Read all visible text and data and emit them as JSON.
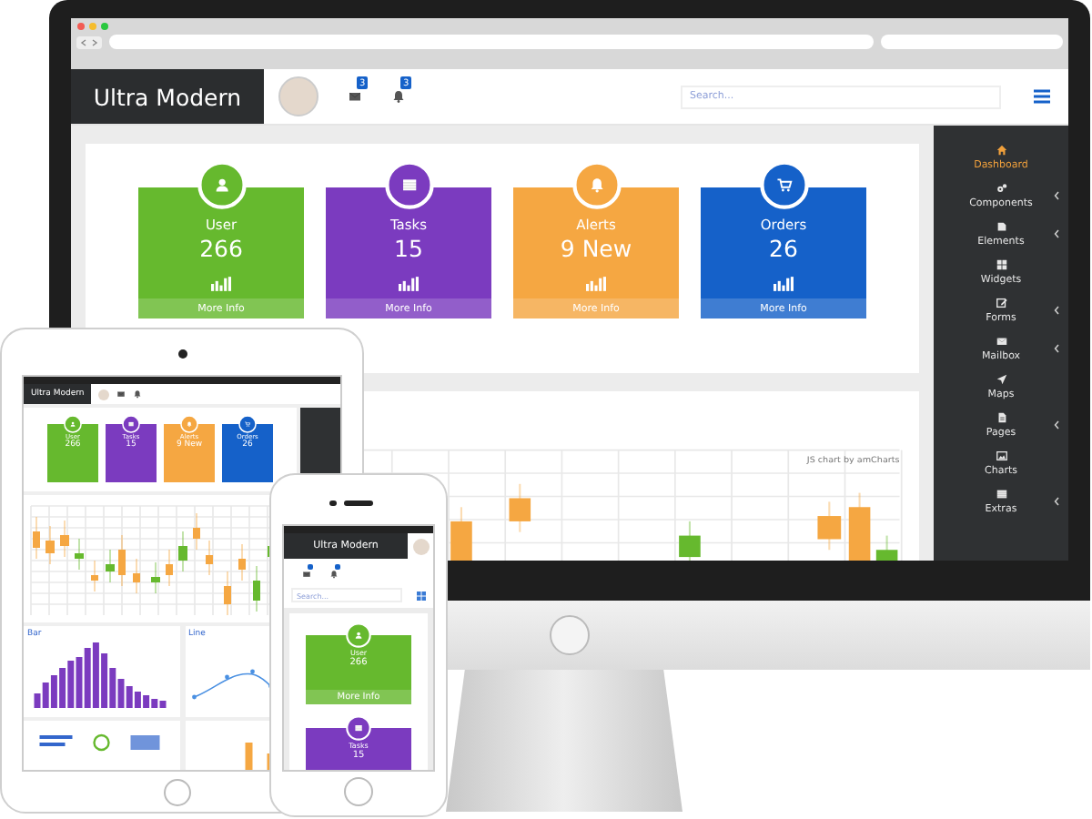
{
  "header": {
    "brand": "Ultra Modern",
    "badges": [
      {
        "kind": "mail",
        "count": "3"
      },
      {
        "kind": "bell",
        "count": "3"
      }
    ],
    "search": {
      "placeholder": "Search..."
    }
  },
  "stat_cards": [
    {
      "kind": "user",
      "label": "User",
      "value": "266",
      "link": "More Info",
      "color": "#66b92e"
    },
    {
      "kind": "tasks",
      "label": "Tasks",
      "value": "15",
      "link": "More Info",
      "color": "#7b3bbf"
    },
    {
      "kind": "alerts",
      "label": "Alerts",
      "value": "9 New",
      "link": "More Info",
      "color": "#f5a742"
    },
    {
      "kind": "orders",
      "label": "Orders",
      "value": "26",
      "link": "More Info",
      "color": "#1561c9"
    }
  ],
  "chart": {
    "credit": "JS chart by amCharts"
  },
  "sidebar": {
    "items": [
      {
        "kind": "dashboard",
        "label": "Dashboard",
        "selected": true,
        "submenu": false
      },
      {
        "kind": "components",
        "label": "Components",
        "selected": false,
        "submenu": true
      },
      {
        "kind": "elements",
        "label": "Elements",
        "selected": false,
        "submenu": true
      },
      {
        "kind": "widgets",
        "label": "Widgets",
        "selected": false,
        "submenu": false
      },
      {
        "kind": "forms",
        "label": "Forms",
        "selected": false,
        "submenu": true
      },
      {
        "kind": "mailbox",
        "label": "Mailbox",
        "selected": false,
        "submenu": true
      },
      {
        "kind": "maps",
        "label": "Maps",
        "selected": false,
        "submenu": false
      },
      {
        "kind": "pages",
        "label": "Pages",
        "selected": false,
        "submenu": true
      },
      {
        "kind": "charts",
        "label": "Charts",
        "selected": false,
        "submenu": false
      },
      {
        "kind": "extras",
        "label": "Extras",
        "selected": false,
        "submenu": true
      }
    ]
  },
  "tablet": {
    "brand": "Ultra Modern",
    "cards": [
      {
        "kind": "user",
        "label": "User",
        "value": "266",
        "color": "#66b92e"
      },
      {
        "kind": "tasks",
        "label": "Tasks",
        "value": "15",
        "color": "#7b3bbf"
      },
      {
        "kind": "alerts",
        "label": "Alerts",
        "value": "9 New",
        "color": "#f5a742"
      },
      {
        "kind": "orders",
        "label": "Orders",
        "value": "26",
        "color": "#1561c9"
      }
    ],
    "panels": [
      {
        "kind": "bar",
        "title": "Bar"
      },
      {
        "kind": "line",
        "title": "Line"
      }
    ]
  },
  "phone": {
    "brand": "Ultra Modern",
    "search": {
      "placeholder": "Search..."
    },
    "cards": [
      {
        "kind": "user",
        "label": "User",
        "value": "266",
        "link": "More Info",
        "color": "#66b92e"
      },
      {
        "kind": "tasks",
        "label": "Tasks",
        "value": "15",
        "color": "#7b3bbf"
      }
    ]
  }
}
